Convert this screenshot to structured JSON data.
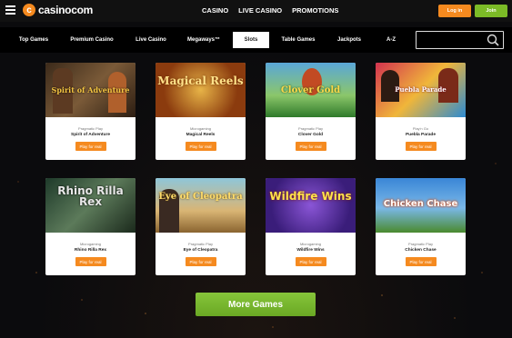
{
  "header": {
    "logo_mark": "c",
    "logo_text": "casinocom",
    "nav": [
      "CASINO",
      "LIVE CASINO",
      "PROMOTIONS"
    ],
    "login_label": "Log in",
    "join_label": "Join"
  },
  "categories": {
    "items": [
      "Top Games",
      "Premium Casino",
      "Live Casino",
      "Megaways™",
      "Slots",
      "Table Games",
      "Jackpots",
      "A-Z"
    ],
    "active": "Slots"
  },
  "search": {
    "value": "",
    "placeholder": ""
  },
  "games": [
    {
      "title_art": "Spirit of Adventure",
      "provider": "Pragmatic Play",
      "name": "Spirit of Adventure",
      "button": "Play for real"
    },
    {
      "title_art": "Magical Reels",
      "provider": "Microgaming",
      "name": "Magical Reels",
      "button": "Play for real"
    },
    {
      "title_art": "Clover Gold",
      "provider": "Pragmatic Play",
      "name": "Clover Gold",
      "button": "Play for real"
    },
    {
      "title_art": "Puebla Parade",
      "provider": "Play'n Go",
      "name": "Puebla Parade",
      "button": "Play for real"
    },
    {
      "title_art": "Rhino Rilla Rex",
      "provider": "Microgaming",
      "name": "Rhino Rilla Rex",
      "button": "Play for real"
    },
    {
      "title_art": "Eye of Cleopatra",
      "provider": "Pragmatic Play",
      "name": "Eye of Cleopatra",
      "button": "Play for real"
    },
    {
      "title_art": "Wildfire Wins",
      "provider": "Microgaming",
      "name": "Wildfire Wins",
      "button": "Play for real"
    },
    {
      "title_art": "Chicken Chase",
      "provider": "Pragmatic Play",
      "name": "Chicken Chase",
      "button": "Play for real"
    }
  ],
  "more_games_label": "More Games",
  "colors": {
    "accent_orange": "#f58a1f",
    "accent_green": "#7cbb27",
    "background": "#0b0b0d"
  }
}
